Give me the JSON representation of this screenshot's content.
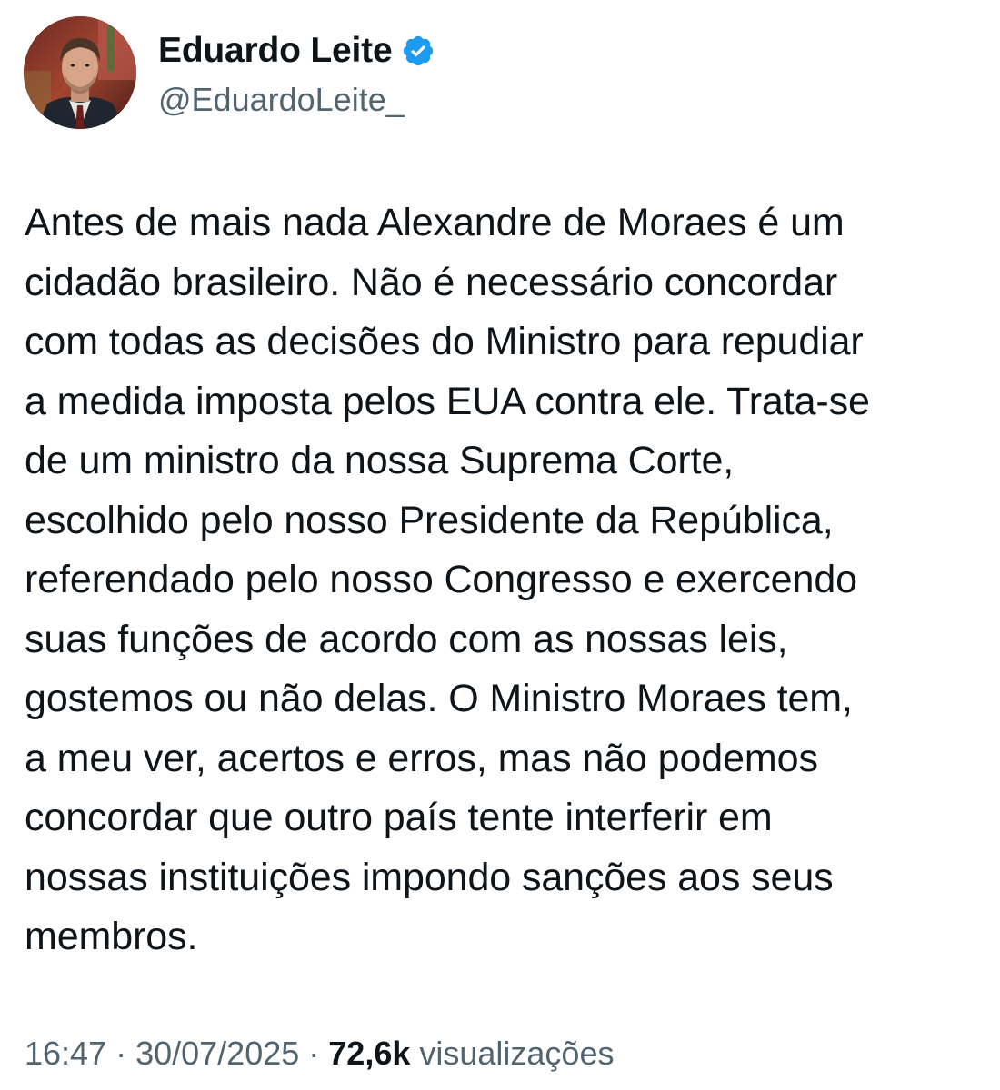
{
  "author": {
    "display_name": "Eduardo Leite",
    "handle": "@EduardoLeite_",
    "verified": true,
    "avatar_icon": "profile-photo",
    "verified_icon": "verified-badge-icon",
    "verified_color": "#1d9bf0"
  },
  "tweet": {
    "text": "Antes de mais nada Alexandre de Moraes é um\ncidadão brasileiro. Não é necessário concordar\ncom todas as decisões do Ministro para repudiar\na medida imposta pelos EUA contra ele. Trata-se\nde um ministro da nossa Suprema Corte,\nescolhido pelo nosso Presidente da República,\nreferendado pelo nosso Congresso e exercendo\nsuas funções de acordo com as nossas leis,\ngostemos ou não delas. O Ministro Moraes tem,\na meu ver, acertos e erros, mas não podemos\nconcordar que outro país tente interferir em\nnossas instituições impondo sanções aos seus\nmembros."
  },
  "meta": {
    "time": "16:47",
    "separator": " · ",
    "date": "30/07/2025",
    "views_count": "72,6k",
    "views_label": " visualizações"
  }
}
